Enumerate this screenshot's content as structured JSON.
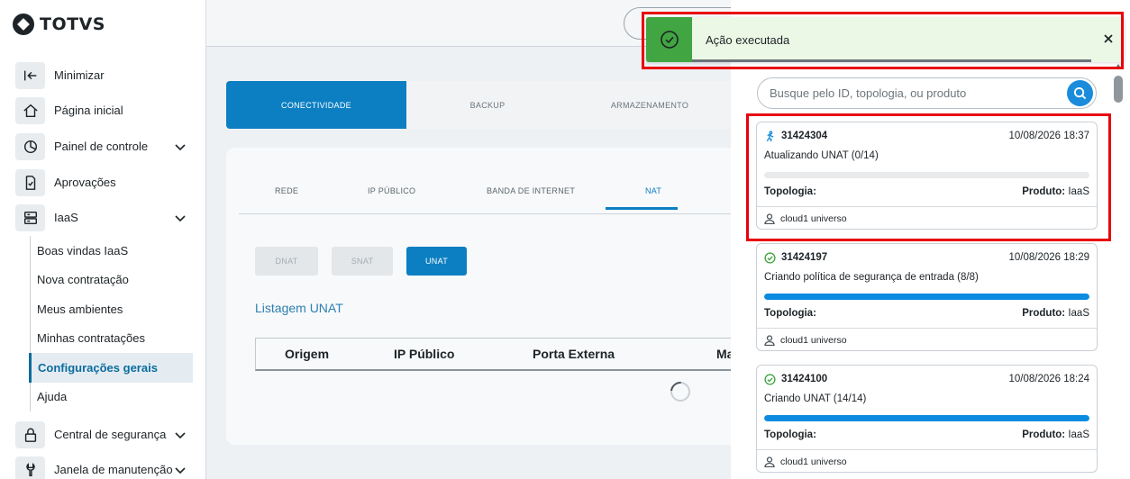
{
  "brand": {
    "name": "TOTVS"
  },
  "sidebar": {
    "items": [
      {
        "label": "Minimizar",
        "icon": "collapse-sidebar-icon"
      },
      {
        "label": "Página inicial",
        "icon": "home-icon"
      },
      {
        "label": "Painel de controle",
        "icon": "pie-chart-icon",
        "expandable": true
      },
      {
        "label": "Aprovações",
        "icon": "document-check-icon"
      },
      {
        "label": "IaaS",
        "icon": "server-icon",
        "expandable": true,
        "expanded": true
      },
      {
        "label": "Central de segurança",
        "icon": "lock-icon",
        "expandable": true
      },
      {
        "label": "Janela de manutenção",
        "icon": "wrench-icon",
        "expandable": true
      }
    ],
    "iaas_subitems": [
      {
        "label": "Boas vindas IaaS"
      },
      {
        "label": "Nova contratação"
      },
      {
        "label": "Meus ambientes"
      },
      {
        "label": "Minhas contratações"
      },
      {
        "label": "Configurações gerais",
        "active": true
      },
      {
        "label": "Ajuda"
      }
    ]
  },
  "main": {
    "top_tabs": [
      "CONECTIVIDADE",
      "BACKUP",
      "ARMAZENAMENTO"
    ],
    "active_top_tab": "CONECTIVIDADE",
    "sub_tabs": [
      "REDE",
      "IP PÚBLICO",
      "BANDA DE INTERNET",
      "NAT"
    ],
    "active_sub_tab": "NAT",
    "nat_types": [
      "DNAT",
      "SNAT",
      "UNAT"
    ],
    "active_nat_type": "UNAT",
    "list_title": "Listagem UNAT",
    "table_headers": [
      "Origem",
      "IP Público",
      "Porta Externa",
      "Ma"
    ]
  },
  "panel": {
    "search_placeholder": "Busque pelo ID, topologia, ou produto",
    "topology_label": "Topologia:",
    "product_label": "Produto:",
    "tasks": [
      {
        "id": "31424304",
        "date": "10/08/2026 18:37",
        "description": "Atualizando UNAT (0/14)",
        "progress": 0,
        "product": "IaaS",
        "user": "cloud1 universo",
        "status": "running"
      },
      {
        "id": "31424197",
        "date": "10/08/2026 18:29",
        "description": "Criando política de segurança de entrada (8/8)",
        "progress": 1,
        "product": "IaaS",
        "user": "cloud1 universo",
        "status": "done"
      },
      {
        "id": "31424100",
        "date": "10/08/2026 18:24",
        "description": "Criando UNAT (14/14)",
        "progress": 1,
        "product": "IaaS",
        "user": "cloud1 universo",
        "status": "done"
      }
    ]
  },
  "toast": {
    "message": "Ação executada",
    "type": "success"
  },
  "colors": {
    "accent": "#0c7fc2",
    "success": "#41a541",
    "highlight": "#e8000d"
  }
}
